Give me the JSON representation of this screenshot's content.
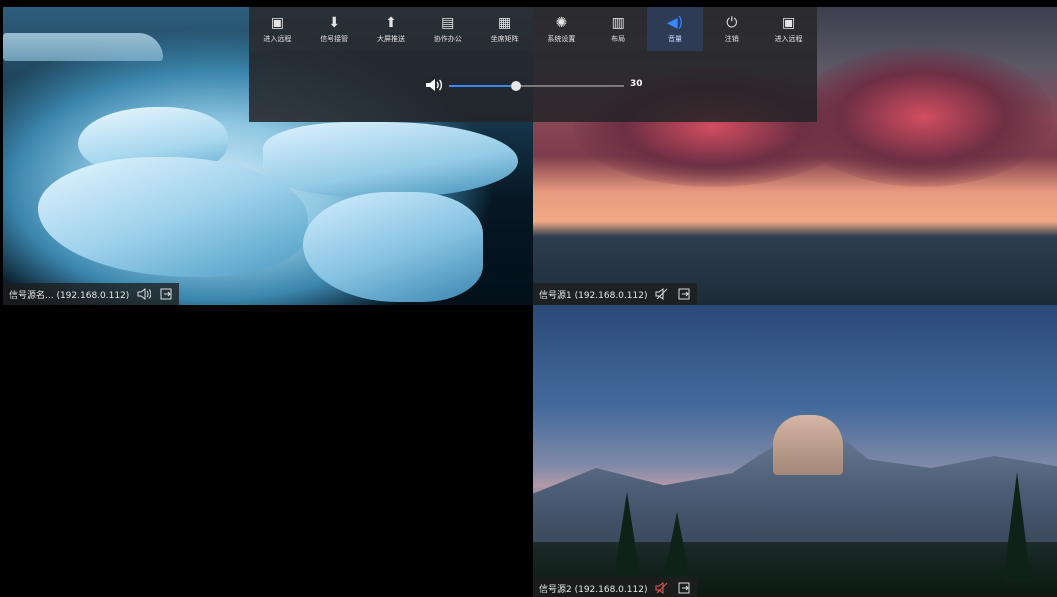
{
  "toolbar": {
    "items": [
      {
        "label": "进入远程",
        "icon": "remote-screen-icon"
      },
      {
        "label": "信号接管",
        "icon": "download-icon"
      },
      {
        "label": "大屏推送",
        "icon": "upload-icon"
      },
      {
        "label": "协作办公",
        "icon": "briefcase-icon"
      },
      {
        "label": "坐席矩阵",
        "icon": "grid-icon"
      },
      {
        "label": "系统设置",
        "icon": "gear-icon"
      },
      {
        "label": "布局",
        "icon": "layout-icon"
      },
      {
        "label": "音量",
        "icon": "speaker-icon",
        "active": true
      },
      {
        "label": "注销",
        "icon": "power-icon"
      },
      {
        "label": "进入远程",
        "icon": "remote-screen-icon"
      }
    ],
    "accent_color": "#3a86ff"
  },
  "volume": {
    "value": "30",
    "level": 0.38
  },
  "tiles": {
    "top_left": {
      "caption": "信号源名... (192.168.0.112)"
    },
    "top_right": {
      "caption": "信号源1 (192.168.0.112)"
    },
    "bottom_right": {
      "caption": "信号源2 (192.168.0.112)"
    }
  }
}
